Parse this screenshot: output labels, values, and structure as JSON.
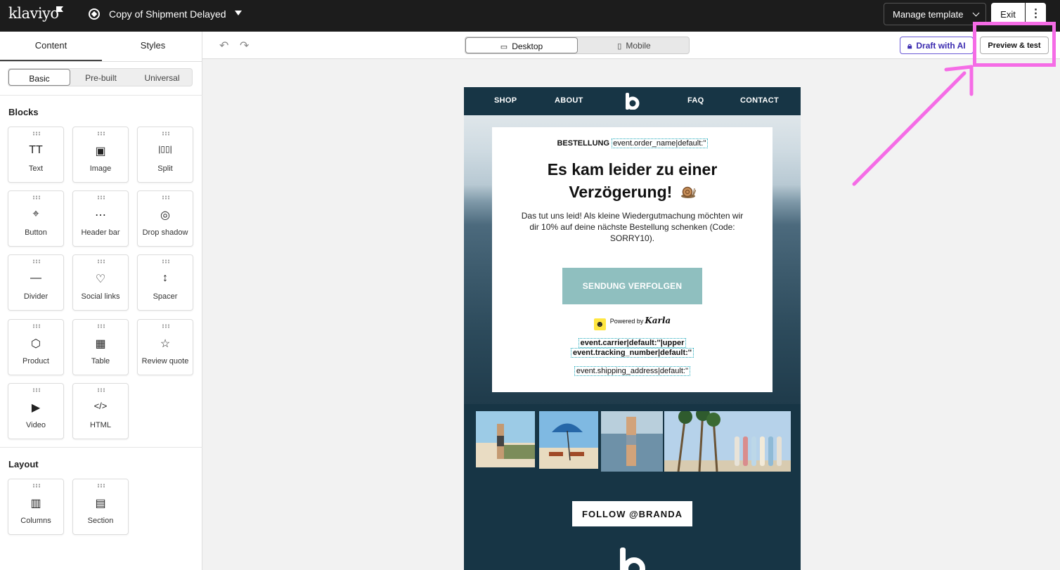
{
  "app": {
    "logo_text": "klaviyo",
    "template_name": "Copy of Shipment Delayed",
    "manage_label": "Manage template",
    "exit_label": "Exit",
    "more_label": "⋮"
  },
  "sidebar": {
    "tabs": [
      {
        "label": "Content",
        "active": true
      },
      {
        "label": "Styles",
        "active": false
      }
    ],
    "segments": [
      {
        "label": "Basic",
        "active": true
      },
      {
        "label": "Pre-built",
        "active": false
      },
      {
        "label": "Universal",
        "active": false
      }
    ],
    "blocks_heading": "Blocks",
    "blocks": [
      {
        "label": "Text",
        "icon": "text-icon",
        "glyph": "TT"
      },
      {
        "label": "Image",
        "icon": "image-icon",
        "glyph": "▣"
      },
      {
        "label": "Split",
        "icon": "split-icon",
        "glyph": "|▯▯|"
      },
      {
        "label": "Button",
        "icon": "button-cursor-icon",
        "glyph": "⌖"
      },
      {
        "label": "Header bar",
        "icon": "header-bar-icon",
        "glyph": "⋯"
      },
      {
        "label": "Drop shadow",
        "icon": "drop-shadow-icon",
        "glyph": "◎"
      },
      {
        "label": "Divider",
        "icon": "divider-icon",
        "glyph": "—"
      },
      {
        "label": "Social links",
        "icon": "heart-icon",
        "glyph": "♡"
      },
      {
        "label": "Spacer",
        "icon": "spacer-icon",
        "glyph": "↕"
      },
      {
        "label": "Product",
        "icon": "product-box-icon",
        "glyph": "⬡"
      },
      {
        "label": "Table",
        "icon": "table-icon",
        "glyph": "▦"
      },
      {
        "label": "Review quote",
        "icon": "review-quote-icon",
        "glyph": "☆"
      },
      {
        "label": "Video",
        "icon": "video-icon",
        "glyph": "▶"
      },
      {
        "label": "HTML",
        "icon": "html-code-icon",
        "glyph": "</>"
      }
    ],
    "layout_heading": "Layout",
    "layout_blocks": [
      {
        "label": "Columns",
        "icon": "columns-icon",
        "glyph": "▥"
      },
      {
        "label": "Section",
        "icon": "section-icon",
        "glyph": "▤"
      }
    ]
  },
  "toolbar": {
    "undo_glyph": "↶",
    "redo_glyph": "↷",
    "views": [
      {
        "label": "Desktop",
        "icon": "desktop-icon",
        "active": true
      },
      {
        "label": "Mobile",
        "icon": "mobile-icon",
        "active": false
      }
    ],
    "draft_label": "Draft with AI",
    "preview_label": "Preview & test"
  },
  "email": {
    "nav": [
      "SHOP",
      "ABOUT",
      "FAQ",
      "CONTACT"
    ],
    "order_prefix": "BESTELLUNG",
    "order_token": "event.order_name|default:''",
    "headline_1": "Es kam leider zu einer",
    "headline_2": "Verzögerung!",
    "body": "Das tut uns leid! Als kleine Wiedergutmachung möchten wir dir 10% auf deine nächste Bestellung schenken (Code: SORRY10).",
    "cta_label": "SENDUNG VERFOLGEN",
    "powered_by": "Powered by",
    "powered_brand": "Karla",
    "token_carrier": "event.carrier|default:''|upper",
    "token_tracking": "event.tracking_number|default:''",
    "token_address": "event.shipping_address|default:''",
    "follow_label": "FOLLOW @BRANDA"
  },
  "colors": {
    "topbar": "#1c1c1c",
    "email_navy": "#173545",
    "cta": "#8fbfbf",
    "highlight": "#f56ce6",
    "ai_purple": "#6b5bd6"
  }
}
